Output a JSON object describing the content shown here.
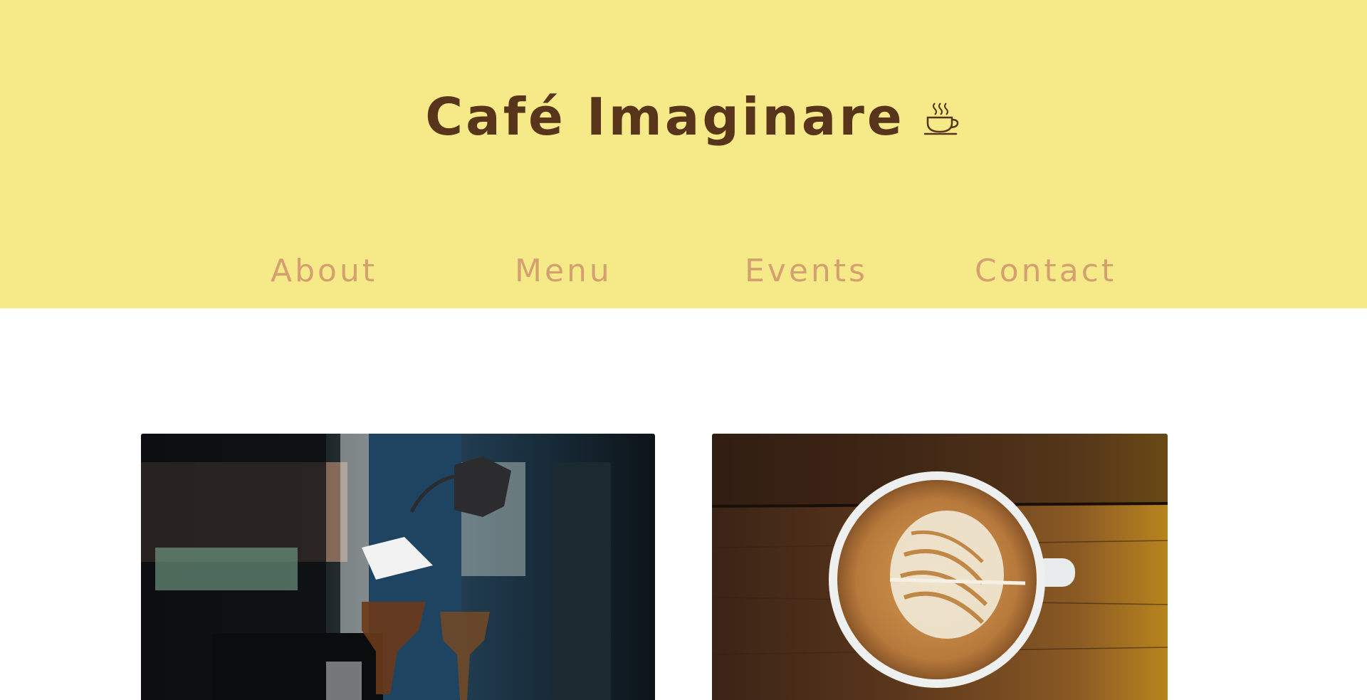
{
  "header": {
    "brand_name": "Café Imaginare",
    "brand_icon": "coffee-cup-icon",
    "background_color": "#f6ea88",
    "brand_color": "#57341a"
  },
  "nav": {
    "items": [
      {
        "label": "About"
      },
      {
        "label": "Menu"
      },
      {
        "label": "Events"
      },
      {
        "label": "Contact"
      }
    ],
    "link_color": "#d4a070"
  },
  "gallery": {
    "images": [
      {
        "subject": "pour-over-coffee-photo"
      },
      {
        "subject": "latte-art-photo"
      }
    ]
  }
}
